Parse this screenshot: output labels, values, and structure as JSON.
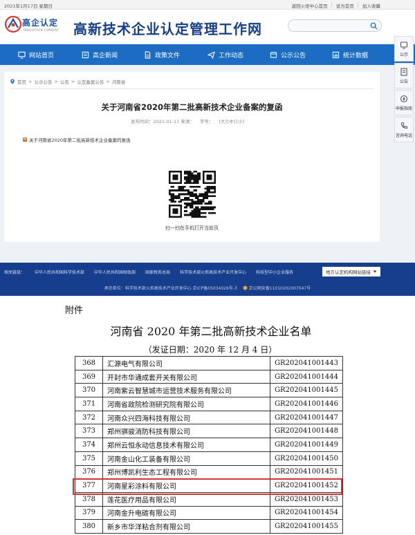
{
  "topbar": {
    "date": "2021年1月17日 星期日",
    "links": [
      "返回火炬中心首页",
      "设为首页",
      "加入收藏"
    ]
  },
  "header": {
    "logo_name": "高企认定",
    "logo_en": "INNOVATION COMPANY",
    "site_title": "高新技术企业认定管理工作网",
    "search_placeholder": ""
  },
  "nav": {
    "items": [
      {
        "label": "网站首页",
        "icon": "monitor-icon"
      },
      {
        "label": "高企新闻",
        "icon": "news-icon"
      },
      {
        "label": "政策文件",
        "icon": "document-icon"
      },
      {
        "label": "工作动态",
        "icon": "send-icon"
      },
      {
        "label": "公示公告",
        "icon": "bulletin-icon"
      },
      {
        "label": "统计数据",
        "icon": "chart-icon"
      }
    ]
  },
  "sidebar": {
    "items": [
      {
        "label": "公示",
        "icon": "board-icon"
      },
      {
        "label": "公告",
        "icon": "notice-icon"
      },
      {
        "label": "申报指南",
        "icon": "guide-icon"
      },
      {
        "label": "咨询电话",
        "icon": "phone-icon"
      }
    ]
  },
  "article": {
    "breadcrumb": [
      "首页",
      "公示公告",
      "公告",
      "认定备案公告",
      "河南省"
    ],
    "title": "关于河南省2020年第二批高新技术企业备案的复函",
    "publish_time": "发布时间：2021-01-11 来源：",
    "font_size_label": "字号：",
    "font_sizes": [
      "[大]",
      "[中]",
      "[小]"
    ],
    "attachment": "关于河南省2020年第二批高新技术企业备案的复函",
    "qr_caption": "扫一扫在手机打开当前页"
  },
  "footer": {
    "links_label": "相关链接：",
    "links": [
      "中华人民共和国科学技术部",
      "中华人民共和国财政部",
      "国家税务总局",
      "科学技术部火炬高技术产业开发中心",
      "科技型中小企业服务"
    ],
    "dropdown": "地方认定机构网站链接",
    "copyright": "承办单位：科学技术部火炬高技术产业开发中心 京ICP备05034026号-3",
    "police": "京公网安备11010202007047号"
  },
  "document": {
    "attachment_label": "附件",
    "title": "河南省 2020 年第二批高新技术企业名单",
    "issue_date": "（发证日期：2020 年 12 月 4 日）",
    "rows": [
      {
        "no": "368",
        "name": "汇源电气有限公司",
        "code": "GR202041001443"
      },
      {
        "no": "369",
        "name": "开封市华通成套开关有限公司",
        "code": "GR202041001444"
      },
      {
        "no": "370",
        "name": "河南紫云智慧城市运营技术服务有限公司",
        "code": "GR202041001445"
      },
      {
        "no": "371",
        "name": "河南省政院检测研究院有限公司",
        "code": "GR202041001446"
      },
      {
        "no": "372",
        "name": "河南众兴四海科技有限公司",
        "code": "GR202041001447"
      },
      {
        "no": "373",
        "name": "郑州骐骏消防科技有限公司",
        "code": "GR202041001448"
      },
      {
        "no": "374",
        "name": "郑州云恒永动信息技术有限公司",
        "code": "GR202041001449"
      },
      {
        "no": "375",
        "name": "河南金山化工装备有限公司",
        "code": "GR202041001450"
      },
      {
        "no": "376",
        "name": "郑州博凯利生态工程有限公司",
        "code": "GR202041001451"
      },
      {
        "no": "377",
        "name": "河南星彩涂料有限公司",
        "code": "GR202041001452"
      },
      {
        "no": "378",
        "name": "莲花医疗用品有限公司",
        "code": "GR202041001453"
      },
      {
        "no": "379",
        "name": "河南金升电碳有限公司",
        "code": "GR202041001454"
      },
      {
        "no": "380",
        "name": "新乡市华洋粘合剂有限公司",
        "code": "GR202041001455"
      }
    ]
  },
  "colors": {
    "nav_blue": "#1c6cc3",
    "title_blue": "#163e8c",
    "footer_blue": "#163e8c",
    "highlight_red": "#cf3535"
  }
}
